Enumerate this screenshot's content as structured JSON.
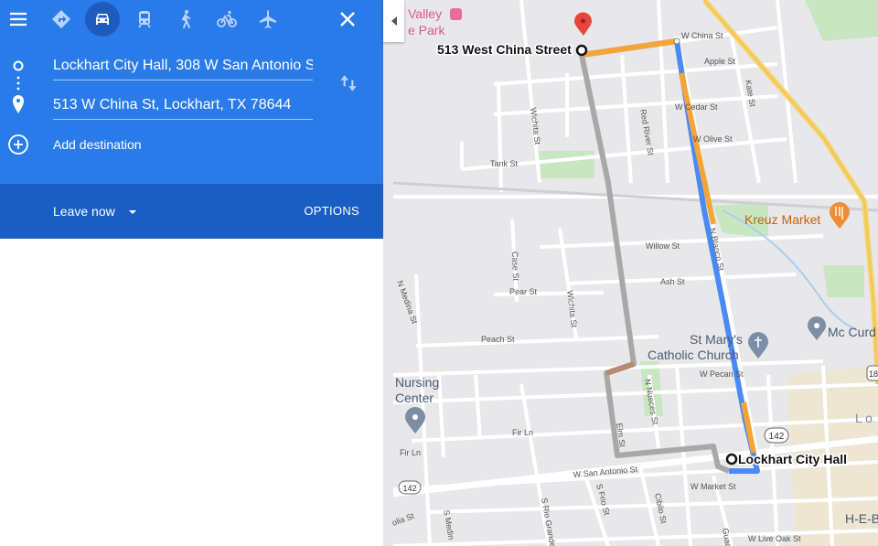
{
  "panel": {
    "origin_value": "Lockhart City Hall, 308 W San Antonio S",
    "destination_value": "513 W China St, Lockhart, TX 78644",
    "add_destination_label": "Add destination",
    "leave_now_label": "Leave now",
    "options_label": "OPTIONS",
    "colors": {
      "panel_blue": "#2a7bea",
      "panel_dark_blue": "#1a5ec4"
    },
    "icons": [
      "menu-icon",
      "directions-icon",
      "car-icon",
      "transit-icon",
      "walk-icon",
      "bicycle-icon",
      "flight-icon",
      "close-icon",
      "swap-icon",
      "add-icon",
      "caret-down-icon"
    ]
  },
  "map": {
    "destination_label": "513 West China Street",
    "origin_label": "Lockhart City Hall",
    "pois": {
      "kreuz": "Kreuz Market",
      "stmarys_line1": "St Mary's",
      "stmarys_line2": "Catholic Church",
      "mccurdy": "Mc Curd",
      "nursing_line1": "Nursing",
      "nursing_line2": "Center",
      "valley_line1": "Valley",
      "valley_line2": "e Park",
      "heb": "H-E-B",
      "lo": "L o"
    },
    "streets": {
      "china": "W China St",
      "apple": "Apple St",
      "cedar": "W Cedar St",
      "olive": "W Olive St",
      "tank": "Tank St",
      "willow": "Willow St",
      "ash": "Ash St",
      "pear": "Pear St",
      "peach": "Peach St",
      "pecan": "W Pecan St",
      "fir": "Fir Ln",
      "fir2": "Fir Ln",
      "san_antonio": "W San Antonio St",
      "market": "W Market St",
      "liveoak": "W Live Oak St",
      "wichita1": "Wichita St",
      "wichita2": "Wichita St",
      "red_river": "Red River St",
      "kate": "Kate St",
      "case": "Case St",
      "medina": "N Medina St",
      "medina2": "S Medin",
      "nueces": "N Nueces St",
      "elm": "Elm St",
      "frio": "S Frio St",
      "cibilo": "Cibilo St",
      "rio_grande": "S Rio Grande",
      "blanco": "N Blanco St",
      "guad": "Guad",
      "olia": "olia St"
    },
    "route_badge_1": "142",
    "route_badge_2": "142",
    "route_badge_3": "18",
    "colors": {
      "route_blue": "#4a8af4",
      "route_orange": "#f5a43a",
      "alt_route_gray": "#a8a8a8",
      "highway_yellow": "#f7d26a",
      "park_green": "#c9e6c2",
      "map_bg": "#e8e8ea"
    }
  }
}
